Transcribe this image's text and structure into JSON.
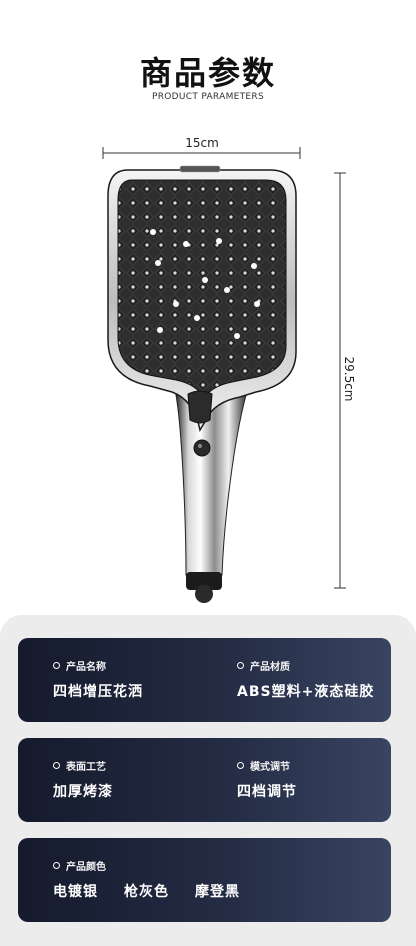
{
  "header": {
    "title": "商品参数",
    "subtitle": "PRODUCT PARAMETERS"
  },
  "dimensions": {
    "width": "15cm",
    "height": "29.5cm"
  },
  "specs": {
    "name": {
      "label": "产品名称",
      "value": "四档增压花洒"
    },
    "material": {
      "label": "产品材质",
      "value": "ABS塑料+液态硅胶"
    },
    "surface": {
      "label": "表面工艺",
      "value": "加厚烤漆"
    },
    "mode": {
      "label": "模式调节",
      "value": "四档调节"
    },
    "color": {
      "label": "产品颜色",
      "values": [
        "电镀银",
        "枪灰色",
        "摩登黑"
      ]
    }
  },
  "colors": {
    "card_dark": "#151a2c",
    "card_light": "#394461",
    "panel": "#ececec"
  }
}
